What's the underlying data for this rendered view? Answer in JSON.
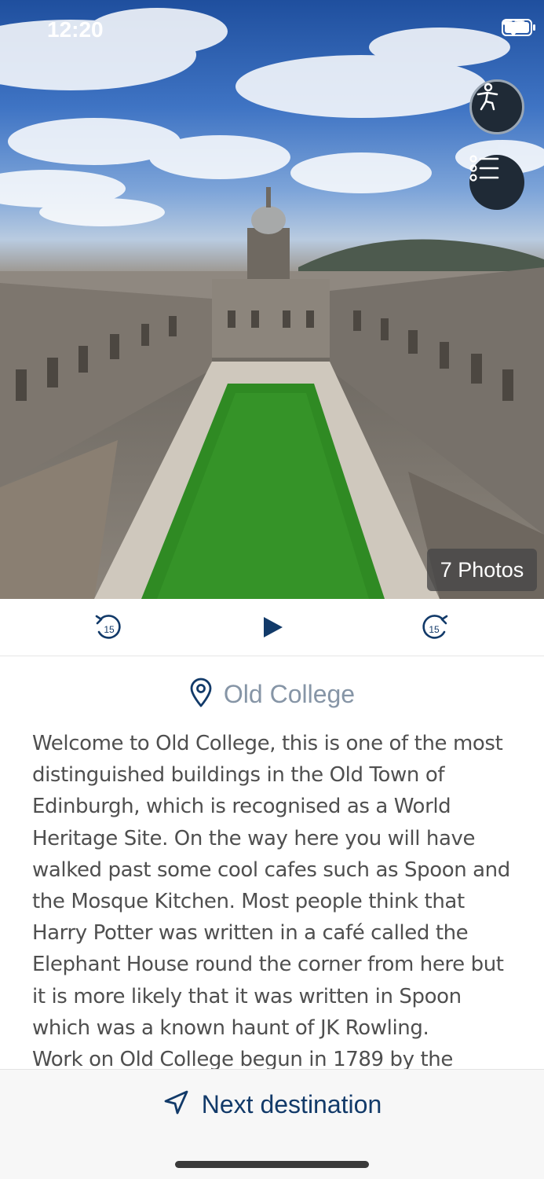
{
  "status_bar": {
    "time": "12:20",
    "icons": [
      "signal-dots-icon",
      "wifi-icon",
      "battery-icon"
    ]
  },
  "hero": {
    "image_description_icon": "photo",
    "photos_badge": "7 Photos",
    "accessibility_icon": "accessibility-person-icon",
    "list_icon": "list-icon"
  },
  "player": {
    "rewind_label": "15",
    "forward_label": "15",
    "play_icon": "play-icon"
  },
  "location": {
    "icon": "map-pin-icon",
    "name": "Old College"
  },
  "description": {
    "paragraph_1": "Welcome to Old College, this is one of the most distinguished buildings in the Old Town of Edinburgh, which is recognised as a World Heritage Site. On the way here you will have walked past some cool cafes such as Spoon and the Mosque Kitchen. Most people think that Harry Potter was written in a café called the Elephant House round the corner from here but it is more likely that it was written in Spoon which was a known haunt of JK Rowling.",
    "paragraph_2": "Work on Old College begun in 1789 by the"
  },
  "bottom": {
    "next_label": "Next destination",
    "next_icon": "navigation-arrow-icon"
  },
  "colors": {
    "accent": "#123a69",
    "location_text": "#8695a6",
    "body_text": "#4f4f4f",
    "fab_bg": "#1f2a36"
  }
}
